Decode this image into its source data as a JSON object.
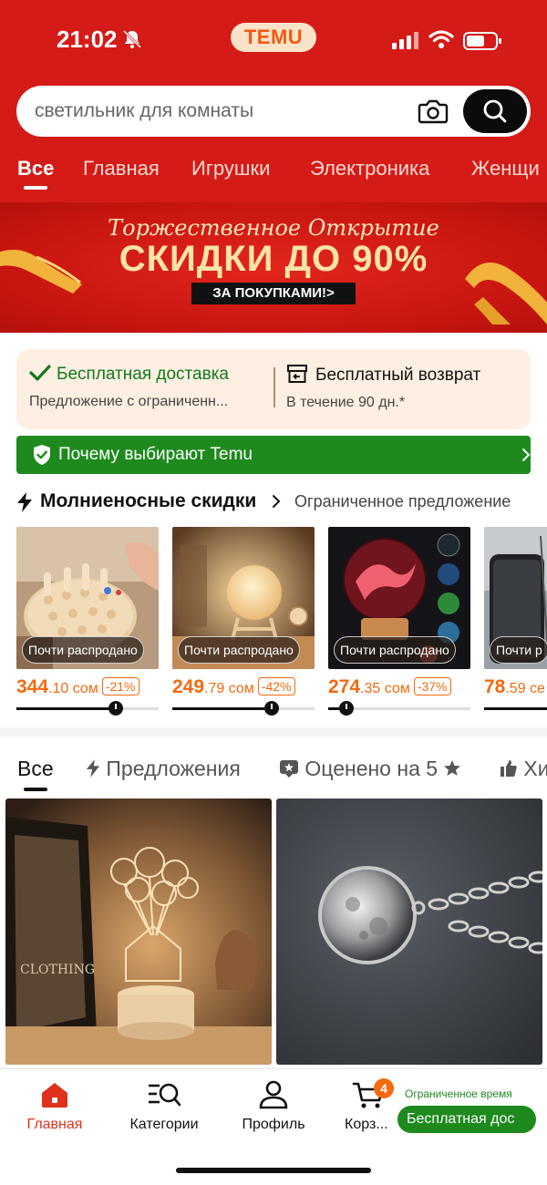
{
  "status_bar": {
    "time": "21:02",
    "app_pill": "TEMU"
  },
  "search": {
    "placeholder": "светильник для комнаты"
  },
  "category_tabs": [
    "Все",
    "Главная",
    "Игрушки",
    "Электроника",
    "Женщи"
  ],
  "banner": {
    "script_text": "Торжественное Открытие",
    "headline": "СКИДКИ ДО 90%",
    "cta": "ЗА ПОКУПКАМИ!>"
  },
  "benefits": {
    "shipping_title": "Бесплатная доставка",
    "shipping_sub": "Предложение с ограниченн...",
    "returns_title": "Бесплатный возврат",
    "returns_sub": "В течение 90 дн.*"
  },
  "why_temu": {
    "label": "Почему выбирают Temu"
  },
  "flash": {
    "title": "Молниеносные скидки",
    "subtitle": "Ограниченное предложение",
    "items": [
      {
        "badge": "Почти распродано",
        "price_main": "344",
        "price_cents": ".10 сом",
        "discount": "-21%",
        "progress": 0.7
      },
      {
        "badge": "Почти распродано",
        "price_main": "249",
        "price_cents": ".79 сом",
        "discount": "-42%",
        "progress": 0.7
      },
      {
        "badge": "Почти распродано",
        "price_main": "274",
        "price_cents": ".35 сом",
        "discount": "-37%",
        "progress": 0.13
      },
      {
        "badge": "Почти р",
        "price_main": "78",
        "price_cents": ".59 се",
        "discount": "",
        "progress": 0.7
      }
    ]
  },
  "feed_tabs": [
    "Все",
    "Предложения",
    "Оценено на 5",
    "Хи"
  ],
  "feed_items": [
    {
      "name": "Balloon house night lamp",
      "image_text": "CLOTHING"
    },
    {
      "name": "Moon glass pendant necklace"
    }
  ],
  "bottom_nav": {
    "items": [
      "Главная",
      "Категории",
      "Профиль",
      "Корз..."
    ],
    "cart_count": "4",
    "limited_label": "Ограниченное время",
    "free_ship": "Бесплатная дос"
  },
  "colors": {
    "brand_red": "#d51b17",
    "accent_orange": "#f26a10",
    "green": "#1e8a1e"
  }
}
